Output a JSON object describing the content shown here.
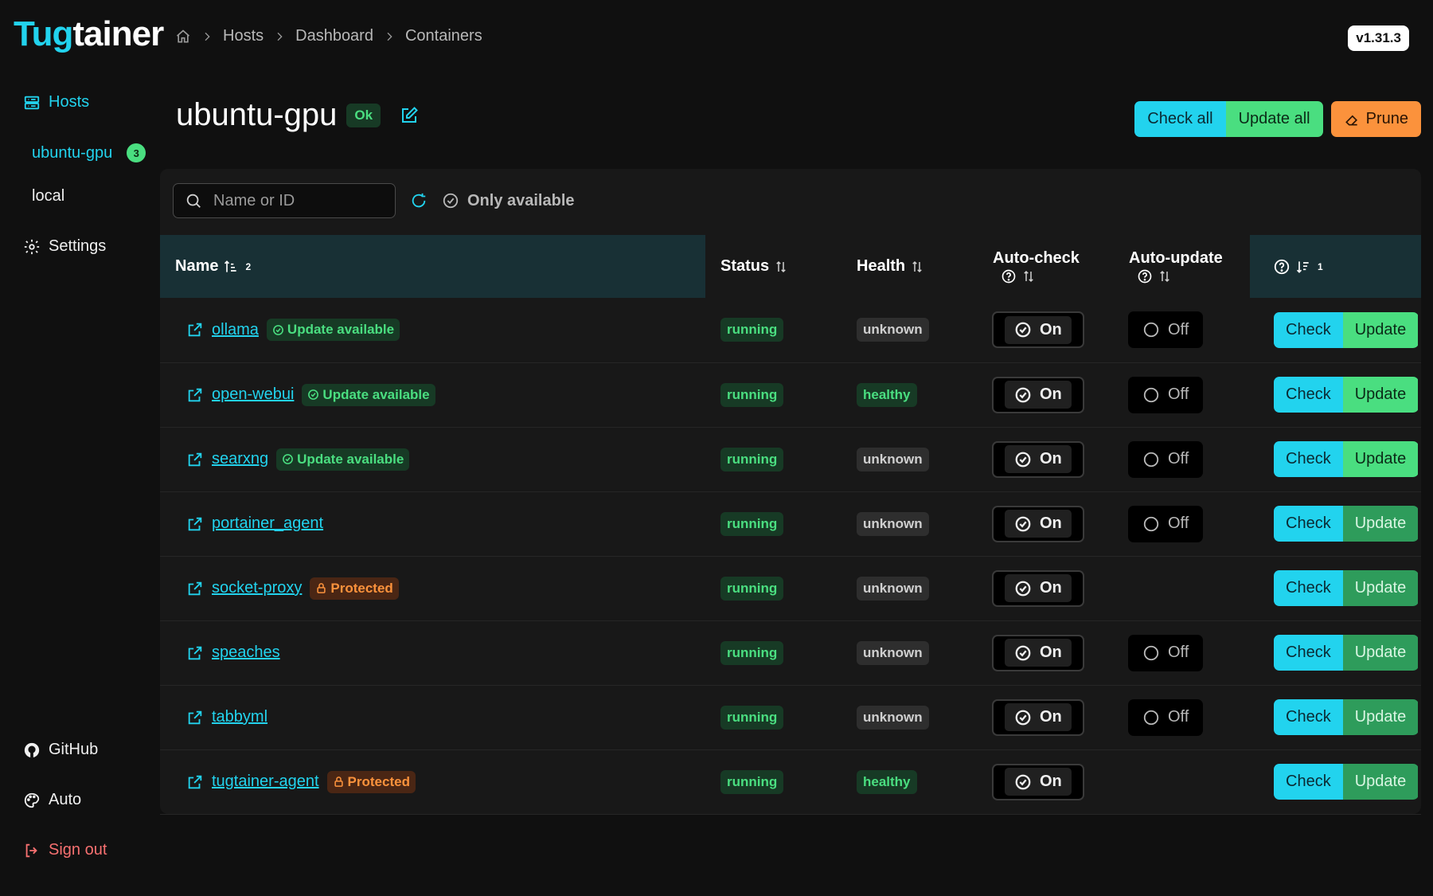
{
  "app": {
    "logo_a": "Tug",
    "logo_b": "tainer",
    "version": "v1.31.3"
  },
  "breadcrumb": [
    "Hosts",
    "Dashboard",
    "Containers"
  ],
  "sidebar": {
    "hosts_label": "Hosts",
    "hosts": [
      {
        "name": "ubuntu-gpu",
        "count": "3"
      },
      {
        "name": "local"
      }
    ],
    "settings": "Settings",
    "github": "GitHub",
    "theme": "Auto",
    "signout": "Sign out"
  },
  "host": {
    "name": "ubuntu-gpu",
    "status": "Ok"
  },
  "actions": {
    "check_all": "Check all",
    "update_all": "Update all",
    "prune": "Prune"
  },
  "filter": {
    "search_placeholder": "Name or ID",
    "only_available": "Only available"
  },
  "columns": {
    "name": "Name",
    "name_sort": "2",
    "status": "Status",
    "health": "Health",
    "auto_check": "Auto-check",
    "auto_update": "Auto-update",
    "actions_sort": "1"
  },
  "row_buttons": {
    "check": "Check",
    "update": "Update"
  },
  "rows": [
    {
      "name": "ollama",
      "tag": "Update available",
      "tag_type": "update",
      "status": "running",
      "health": "unknown",
      "auto_check": "On",
      "auto_update": "Off",
      "update_enabled": true
    },
    {
      "name": "open-webui",
      "tag": "Update available",
      "tag_type": "update",
      "status": "running",
      "health": "healthy",
      "auto_check": "On",
      "auto_update": "Off",
      "update_enabled": true
    },
    {
      "name": "searxng",
      "tag": "Update available",
      "tag_type": "update",
      "status": "running",
      "health": "unknown",
      "auto_check": "On",
      "auto_update": "Off",
      "update_enabled": true
    },
    {
      "name": "portainer_agent",
      "tag": "",
      "tag_type": "",
      "status": "running",
      "health": "unknown",
      "auto_check": "On",
      "auto_update": "Off",
      "update_enabled": false
    },
    {
      "name": "socket-proxy",
      "tag": "Protected",
      "tag_type": "protected",
      "status": "running",
      "health": "unknown",
      "auto_check": "On",
      "auto_update": "",
      "update_enabled": false
    },
    {
      "name": "speaches",
      "tag": "",
      "tag_type": "",
      "status": "running",
      "health": "unknown",
      "auto_check": "On",
      "auto_update": "Off",
      "update_enabled": false
    },
    {
      "name": "tabbyml",
      "tag": "",
      "tag_type": "",
      "status": "running",
      "health": "unknown",
      "auto_check": "On",
      "auto_update": "Off",
      "update_enabled": false
    },
    {
      "name": "tugtainer-agent",
      "tag": "Protected",
      "tag_type": "protected",
      "status": "running",
      "health": "healthy",
      "auto_check": "On",
      "auto_update": "",
      "update_enabled": false
    }
  ]
}
